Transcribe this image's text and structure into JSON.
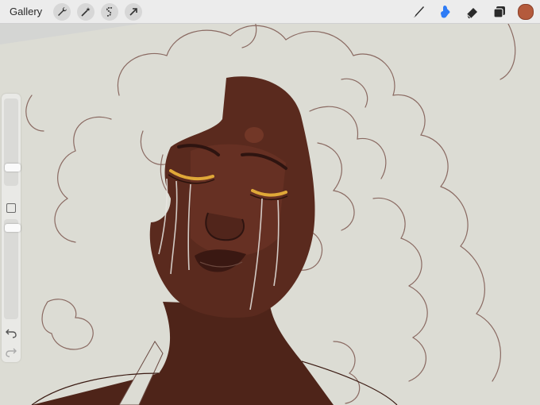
{
  "topbar": {
    "gallery_label": "Gallery",
    "left_tools": [
      "wrench-icon",
      "magic-wand-icon",
      "selection-icon",
      "transform-arrow-icon"
    ],
    "right_tools": [
      "brush-icon",
      "smudge-icon",
      "eraser-icon",
      "layers-icon"
    ],
    "active_tool": "smudge-icon",
    "current_color": "#b45a3c"
  },
  "sidebar": {
    "brush_size_level": 0.18,
    "opacity_level": 0.95,
    "icons": [
      "modify-square-icon",
      "undo-icon",
      "redo-icon"
    ]
  },
  "colors": {
    "canvas_bg": "#dcdcd4",
    "skin": "#5a2a1e",
    "sketch_line": "#8a6a62",
    "accent_blue": "#2e7cf6",
    "eye_gold": "#e0a838"
  }
}
